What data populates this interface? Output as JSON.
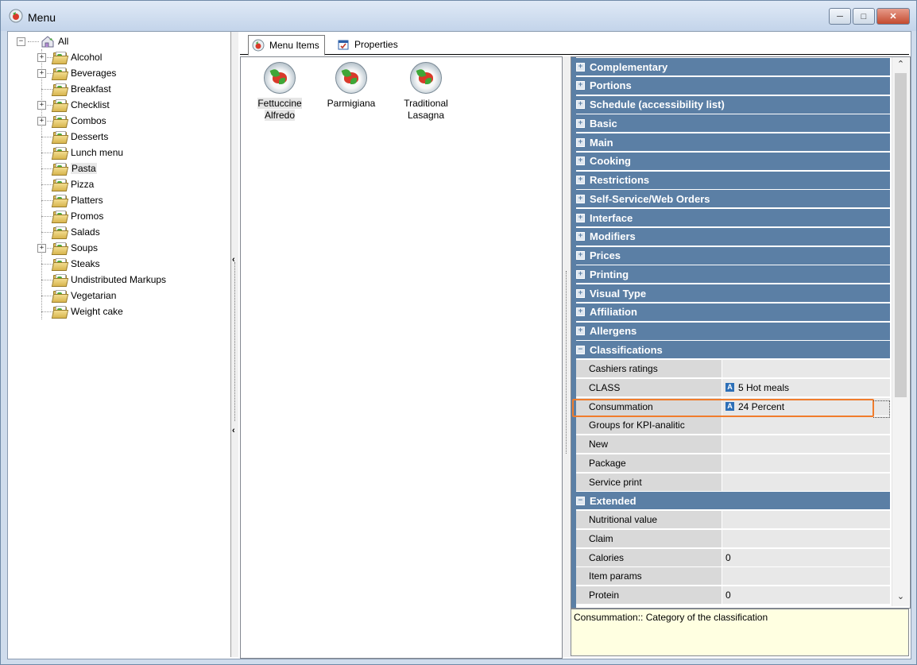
{
  "window": {
    "title": "Menu"
  },
  "tree": {
    "root": "All",
    "items": [
      {
        "label": "Alcohol",
        "expandable": true
      },
      {
        "label": "Beverages",
        "expandable": true
      },
      {
        "label": "Breakfast",
        "expandable": false
      },
      {
        "label": "Checklist",
        "expandable": true
      },
      {
        "label": "Combos",
        "expandable": true
      },
      {
        "label": "Desserts",
        "expandable": false
      },
      {
        "label": "Lunch menu",
        "expandable": false
      },
      {
        "label": "Pasta",
        "expandable": false,
        "selected": true
      },
      {
        "label": "Pizza",
        "expandable": false
      },
      {
        "label": "Platters",
        "expandable": false
      },
      {
        "label": "Promos",
        "expandable": false
      },
      {
        "label": "Salads",
        "expandable": false
      },
      {
        "label": "Soups",
        "expandable": true
      },
      {
        "label": "Steaks",
        "expandable": false
      },
      {
        "label": "Undistributed Markups",
        "expandable": false
      },
      {
        "label": "Vegetarian",
        "expandable": false
      },
      {
        "label": "Weight cake",
        "expandable": false
      }
    ]
  },
  "tabs": {
    "menu_items": "Menu Items",
    "properties": "Properties"
  },
  "menu_items": [
    {
      "label": "Fettuccine Alfredo",
      "selected": true
    },
    {
      "label": "Parmigiana",
      "selected": false
    },
    {
      "label": "Traditional Lasagna",
      "selected": false
    }
  ],
  "property_grid": {
    "rows": [
      {
        "type": "cat",
        "label": "Complementary",
        "collapsed": true
      },
      {
        "type": "cat",
        "label": "Portions",
        "collapsed": true
      },
      {
        "type": "cat",
        "label": "Schedule (accessibility list)",
        "collapsed": true
      },
      {
        "type": "cat",
        "label": "Basic",
        "collapsed": true
      },
      {
        "type": "cat",
        "label": "Main",
        "collapsed": true
      },
      {
        "type": "cat",
        "label": "Cooking",
        "collapsed": true
      },
      {
        "type": "cat",
        "label": "Restrictions",
        "collapsed": true
      },
      {
        "type": "cat",
        "label": "Self-Service/Web Orders",
        "collapsed": true
      },
      {
        "type": "cat",
        "label": "Interface",
        "collapsed": true
      },
      {
        "type": "cat",
        "label": "Modifiers",
        "collapsed": true
      },
      {
        "type": "cat",
        "label": "Prices",
        "collapsed": true
      },
      {
        "type": "cat",
        "label": "Printing",
        "collapsed": true
      },
      {
        "type": "cat",
        "label": "Visual Type",
        "collapsed": true
      },
      {
        "type": "cat",
        "label": "Affiliation",
        "collapsed": true
      },
      {
        "type": "cat",
        "label": "Allergens",
        "collapsed": true
      },
      {
        "type": "cat",
        "label": "Classifications",
        "collapsed": false
      },
      {
        "type": "prop",
        "name": "Cashiers ratings",
        "value": ""
      },
      {
        "type": "prop",
        "name": "CLASS",
        "value": "5 Hot meals",
        "icon": "A"
      },
      {
        "type": "prop",
        "name": "Consummation",
        "value": "24 Percent",
        "icon": "A",
        "highlighted": true
      },
      {
        "type": "prop",
        "name": "Groups for KPI-analitic",
        "value": ""
      },
      {
        "type": "prop",
        "name": "New",
        "value": ""
      },
      {
        "type": "prop",
        "name": "Package",
        "value": ""
      },
      {
        "type": "prop",
        "name": "Service print",
        "value": ""
      },
      {
        "type": "cat",
        "label": "Extended",
        "collapsed": false
      },
      {
        "type": "prop",
        "name": "Nutritional value",
        "value": ""
      },
      {
        "type": "prop",
        "name": "Claim",
        "value": ""
      },
      {
        "type": "prop",
        "name": "Calories",
        "value": "0"
      },
      {
        "type": "prop",
        "name": "Item params",
        "value": ""
      },
      {
        "type": "prop",
        "name": "Protein",
        "value": "0"
      }
    ]
  },
  "description": "Consummation:: Category of the classification",
  "colors": {
    "category_header": "#5b7fa5",
    "highlight_border": "#f07c2c",
    "description_bg": "#ffffe1"
  }
}
